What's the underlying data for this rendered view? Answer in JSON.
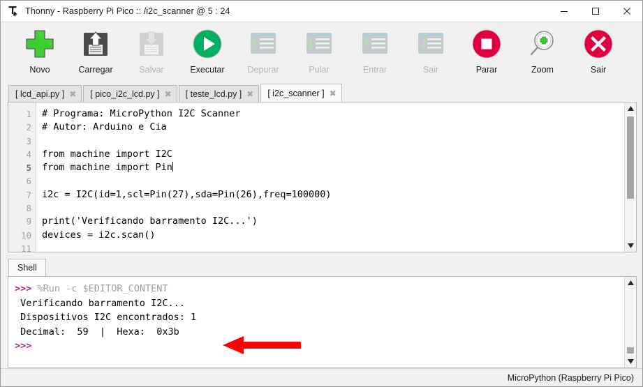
{
  "window": {
    "title": "Thonny  -  Raspberry Pi Pico :: /i2c_scanner  @  5 : 24",
    "app_icon": "thonny-icon",
    "controls": {
      "minimize": "minimize-icon",
      "maximize": "maximize-icon",
      "close": "close-icon"
    }
  },
  "toolbar": {
    "items": [
      {
        "label": "Novo",
        "icon": "new-file-plus-icon",
        "enabled": true
      },
      {
        "label": "Carregar",
        "icon": "load-floppy-up-icon",
        "enabled": true
      },
      {
        "label": "Salvar",
        "icon": "save-floppy-down-icon",
        "enabled": false
      },
      {
        "label": "Executar",
        "icon": "run-play-icon",
        "enabled": true
      },
      {
        "label": "Depurar",
        "icon": "debug-icon",
        "enabled": false
      },
      {
        "label": "Pular",
        "icon": "step-over-icon",
        "enabled": false
      },
      {
        "label": "Entrar",
        "icon": "step-into-icon",
        "enabled": false
      },
      {
        "label": "Sair",
        "icon": "step-out-icon",
        "enabled": false
      },
      {
        "label": "Parar",
        "icon": "stop-square-icon",
        "enabled": true
      },
      {
        "label": "Zoom",
        "icon": "zoom-magnifier-icon",
        "enabled": true
      },
      {
        "label": "Sair",
        "icon": "quit-x-icon",
        "enabled": true
      }
    ]
  },
  "editor": {
    "tabs": [
      {
        "label": "[ lcd_api.py ]",
        "active": false,
        "close": "✖"
      },
      {
        "label": "[ pico_i2c_lcd.py ]",
        "active": false,
        "close": "✖"
      },
      {
        "label": "[ teste_lcd.py ]",
        "active": false,
        "close": "✖"
      },
      {
        "label": "[ i2c_scanner ]",
        "active": true,
        "close": "✖"
      }
    ],
    "line_numbers": [
      "1",
      "2",
      "3",
      "4",
      "5",
      "6",
      "7",
      "8",
      "9",
      "10",
      "11"
    ],
    "current_line": 5,
    "lines": [
      "# Programa: MicroPython I2C Scanner",
      "# Autor: Arduino e Cia",
      "",
      "from machine import I2C",
      "from machine import Pin",
      "",
      "i2c = I2C(id=1,scl=Pin(27),sda=Pin(26),freq=100000)",
      "",
      "print('Verificando barramento I2C...')",
      "devices = i2c.scan()",
      ""
    ],
    "cursor_line_index": 4
  },
  "shell": {
    "tab_label": "Shell",
    "lines": [
      {
        "prompt": ">>>",
        "command": "%Run -c $EDITOR_CONTENT",
        "output": ""
      },
      {
        "prompt": "",
        "command": "",
        "output": " Verificando barramento I2C..."
      },
      {
        "prompt": "",
        "command": "",
        "output": " Dispositivos I2C encontrados: 1"
      },
      {
        "prompt": "",
        "command": "",
        "output": " Decimal:  59  |  Hexa:  0x3b"
      },
      {
        "prompt": ">>>",
        "command": "",
        "output": ""
      }
    ]
  },
  "annotation": {
    "name": "red-pointer-arrow",
    "color": "#FF0000"
  },
  "statusbar": {
    "interpreter": "MicroPython (Raspberry Pi Pico)"
  },
  "colors": {
    "green": "#3ECC33",
    "run_green": "#00B060",
    "red": "#E00040",
    "prompt_purple": "#A5258F",
    "disabled_grey": "#B4B4B4",
    "window_bg": "#F0F0F0"
  }
}
